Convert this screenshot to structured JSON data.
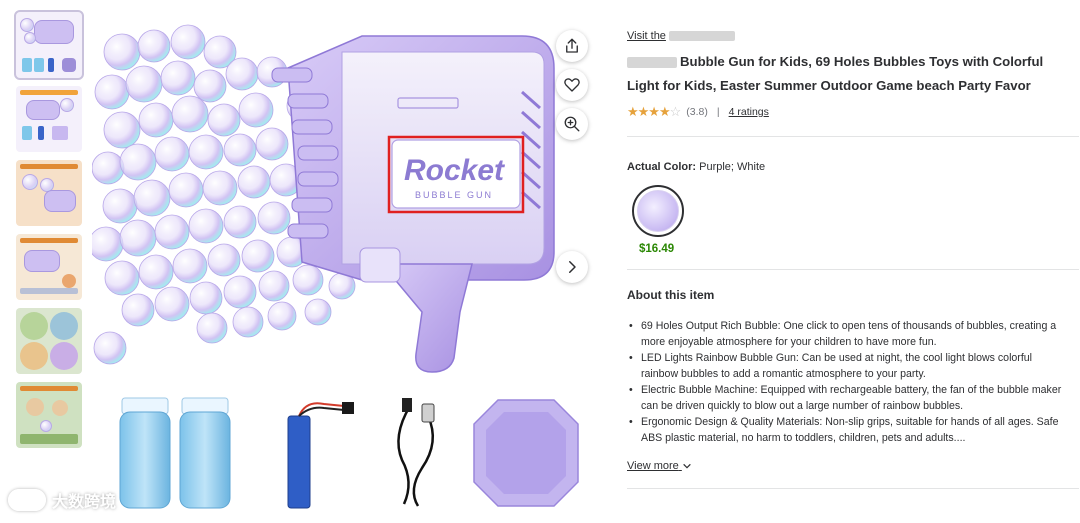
{
  "product": {
    "visit_prefix": "Visit the",
    "title": "Bubble Gun for Kids, 69 Holes Bubbles Toys with Colorful Light for Kids, Easter Summer Outdoor Game beach Party Favor",
    "rating_stars": "★★★★",
    "rating_half": "☆",
    "rating_value": "(3.8)",
    "rating_separator": "|",
    "ratings_link": "4 ratings",
    "actual_color_label": "Actual Color:",
    "actual_color_value": "Purple; White",
    "price": "$16.49",
    "swatch_color": "#c8b9f2"
  },
  "about": {
    "title": "About this item",
    "bullets": [
      "69 Holes Output Rich Bubble: One click to open tens of thousands of bubbles, creating a more enjoyable atmosphere for your children to have more fun.",
      "LED Lights Rainbow Bubble Gun: Can be used at night, the cool light blows colorful rainbow bubbles to add a romantic atmosphere to your party.",
      "Electric Bubble Machine: Equipped with rechargeable battery, the fan of the bubble maker can be driven quickly to blow out a large number of rainbow bubbles.",
      "Ergonomic Design & Quality Materials: Non-slip grips, suitable for hands of all ages. Safe ABS plastic material, no harm to toddlers, children, pets and adults...."
    ],
    "view_more": "View more"
  },
  "image": {
    "brand_word": "Rocket",
    "brand_sub": "BUBBLE GUN",
    "highlight_color": "#e02020",
    "gun_color": "#c8b8f0"
  },
  "watermark": {
    "text": "大数跨境"
  },
  "icons": {
    "share": "share-icon",
    "favorite": "heart-icon",
    "zoom": "zoom-in-icon",
    "next": "chevron-right-icon",
    "view_more": "chevron-down-icon"
  }
}
